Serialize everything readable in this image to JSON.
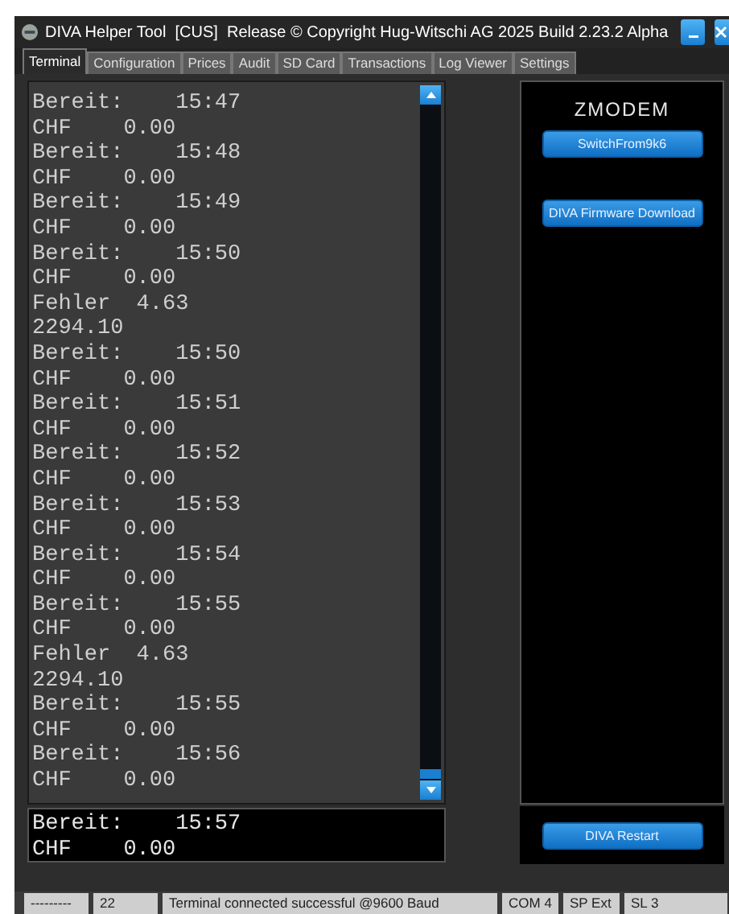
{
  "window": {
    "title": "DIVA Helper Tool  [CUS]  Release © Copyright Hug-Witschi AG 2025 Build 2.23.2 Alpha"
  },
  "tabs": [
    {
      "label": "Terminal",
      "selected": true
    },
    {
      "label": "Configuration",
      "selected": false
    },
    {
      "label": "Prices",
      "selected": false
    },
    {
      "label": "Audit",
      "selected": false
    },
    {
      "label": "SD Card",
      "selected": false
    },
    {
      "label": "Transactions",
      "selected": false
    },
    {
      "label": "Log Viewer",
      "selected": false
    },
    {
      "label": "Settings",
      "selected": false
    }
  ],
  "terminal": {
    "lines": [
      "Bereit:    15:47",
      "CHF    0.00",
      "Bereit:    15:48",
      "CHF    0.00",
      "Bereit:    15:49",
      "CHF    0.00",
      "Bereit:    15:50",
      "CHF    0.00",
      "Fehler  4.63",
      "2294.10",
      "Bereit:    15:50",
      "CHF    0.00",
      "Bereit:    15:51",
      "CHF    0.00",
      "Bereit:    15:52",
      "CHF    0.00",
      "Bereit:    15:53",
      "CHF    0.00",
      "Bereit:    15:54",
      "CHF    0.00",
      "Bereit:    15:55",
      "CHF    0.00",
      "Fehler  4.63",
      "2294.10",
      "Bereit:    15:55",
      "CHF    0.00",
      "Bereit:    15:56",
      "CHF    0.00"
    ],
    "display": [
      "Bereit:    15:57",
      "CHF    0.00"
    ]
  },
  "side_panel": {
    "heading": "ZMODEM",
    "buttons": [
      "SwitchFrom9k6",
      "DIVA Firmware Download"
    ],
    "restart_button": "DIVA Restart"
  },
  "status_bar": [
    "---------",
    "22",
    "Terminal connected successful @9600 Baud",
    "COM 4",
    "SP Ext",
    "SL 3"
  ]
}
